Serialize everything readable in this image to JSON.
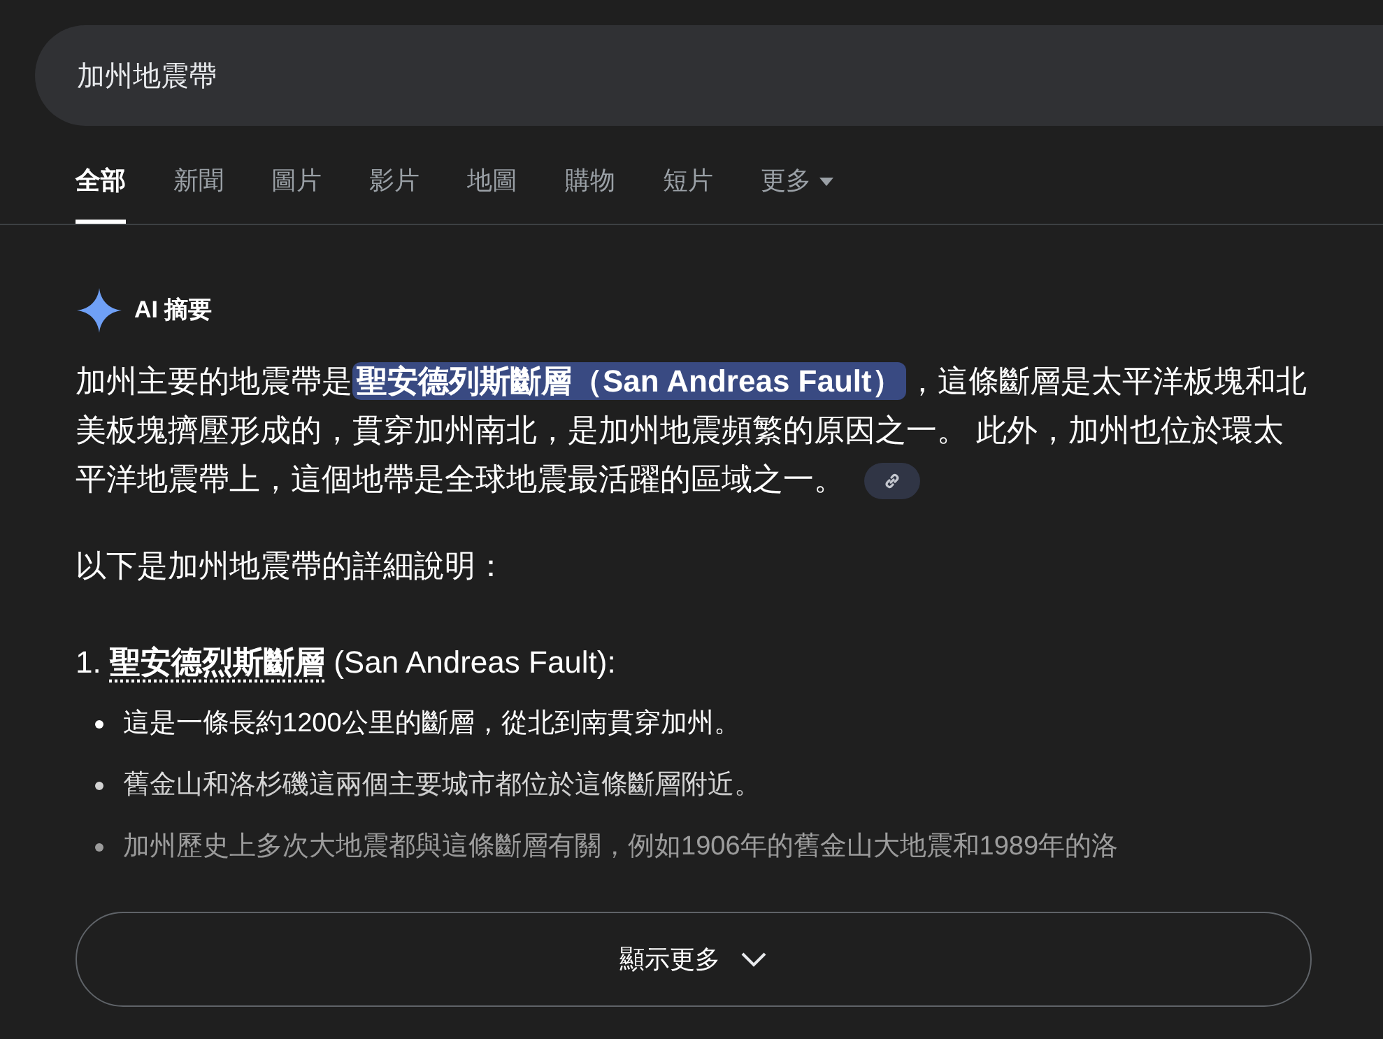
{
  "search": {
    "value": "加州地震帶"
  },
  "tabs": [
    {
      "label": "全部",
      "selected": true
    },
    {
      "label": "新聞",
      "selected": false
    },
    {
      "label": "圖片",
      "selected": false
    },
    {
      "label": "影片",
      "selected": false
    },
    {
      "label": "地圖",
      "selected": false
    },
    {
      "label": "購物",
      "selected": false
    },
    {
      "label": "短片",
      "selected": false
    },
    {
      "label": "更多",
      "selected": false,
      "kind": "dropdown"
    }
  ],
  "ai_overview": {
    "title": "AI 摘要",
    "summary": [
      {
        "kind": "text",
        "text": "加州主要的地震帶是"
      },
      {
        "kind": "highlight",
        "text": "聖安德列斯斷層（San Andreas Fault）"
      },
      {
        "kind": "text",
        "text": "，這條斷層是太平洋板塊和北美板塊擠壓形成的，貫穿加州南北，是加州地震頻繁的原因之一。 此外，加州也位於環太平洋地震帶上，這個地帶是全球地震最活躍的區域之一。"
      }
    ],
    "intro": "以下是加州地震帶的詳細說明：",
    "sections": [
      {
        "number": "1.",
        "term": "聖安德烈斯斷層",
        "rest": " (San Andreas Fault):",
        "bullets": [
          "這是一條長約1200公里的斷層，從北到南貫穿加州。",
          "舊金山和洛杉磯這兩個主要城市都位於這條斷層附近。",
          "加州歷史上多次大地震都與這條斷層有關，例如1906年的舊金山大地震和1989年的洛"
        ]
      }
    ],
    "show_more": "顯示更多"
  }
}
